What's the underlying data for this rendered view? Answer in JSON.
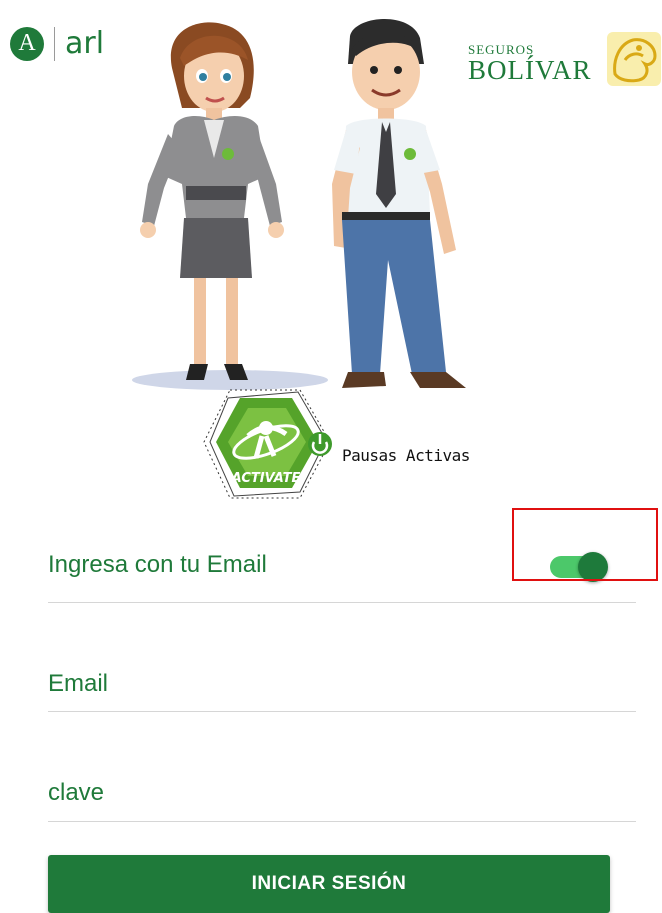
{
  "header": {
    "arl_letter": "A",
    "arl_text": "arl",
    "bolivar_small": "SEGUROS",
    "bolivar_big": "BOLÍVAR"
  },
  "badge": {
    "activate_text": "ACTIVATE",
    "pausas_label": "Pausas Activas"
  },
  "form": {
    "toggle_label": "Ingresa con tu Email",
    "toggle_on": true,
    "email_placeholder": "Email",
    "password_placeholder": "clave",
    "submit_label": "INICIAR SESIÓN"
  },
  "colors": {
    "brand_green": "#1f7a3a",
    "toggle_track": "#4cc86a",
    "highlight": "#e01010"
  }
}
